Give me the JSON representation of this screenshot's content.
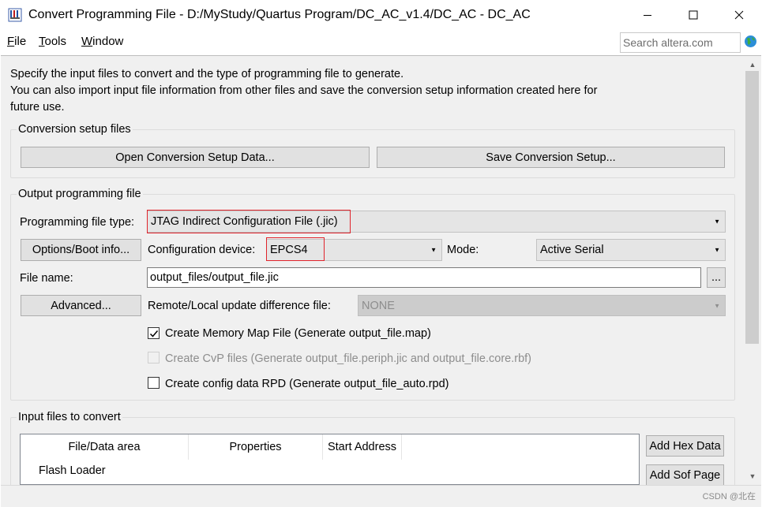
{
  "window": {
    "title": "Convert Programming File - D:/MyStudy/Quartus Program/DC_AC_v1.4/DC_AC - DC_AC",
    "app_icon": "quartus-programmer-icon",
    "controls": {
      "minimize": "minimize-icon",
      "maximize": "maximize-icon",
      "close": "close-icon"
    }
  },
  "menu": {
    "items": [
      {
        "key": "F",
        "rest": "ile"
      },
      {
        "key": "T",
        "rest": "ools"
      },
      {
        "key": "W",
        "rest": "indow"
      }
    ],
    "search_placeholder": "Search altera.com",
    "search_icon": "globe-icon"
  },
  "intro": {
    "line1": "Specify the input files to convert and the type of programming file to generate.",
    "line2": "You can also import input file information from other files and save the conversion setup information created here for",
    "line3": "future use."
  },
  "conversion_setup": {
    "title": "Conversion setup files",
    "open_button": "Open Conversion Setup Data...",
    "save_button": "Save Conversion Setup..."
  },
  "output": {
    "title": "Output programming file",
    "file_type_label": "Programming file type:",
    "file_type_value": "JTAG Indirect Configuration File (.jic)",
    "options_button": "Options/Boot info...",
    "config_device_label": "Configuration device:",
    "config_device_value": "EPCS4",
    "mode_label": "Mode:",
    "mode_value": "Active Serial",
    "file_name_label": "File name:",
    "file_name_value": "output_files/output_file.jic",
    "browse_button": "...",
    "advanced_button": "Advanced...",
    "remote_label": "Remote/Local update difference file:",
    "remote_value": "NONE",
    "options": [
      {
        "label": "Create Memory Map File (Generate output_file.map)",
        "checked": true,
        "enabled": true
      },
      {
        "label": "Create CvP files (Generate output_file.periph.jic and output_file.core.rbf)",
        "checked": false,
        "enabled": false
      },
      {
        "label": "Create config data RPD (Generate output_file_auto.rpd)",
        "checked": false,
        "enabled": true
      }
    ]
  },
  "input_files": {
    "title": "Input files to convert",
    "columns": [
      "File/Data area",
      "Properties",
      "Start Address"
    ],
    "rows": [
      {
        "file": "Flash Loader",
        "properties": "",
        "start": ""
      }
    ],
    "add_hex_button": "Add Hex Data",
    "add_sof_button": "Add Sof Page"
  },
  "watermark": "CSDN @北在"
}
